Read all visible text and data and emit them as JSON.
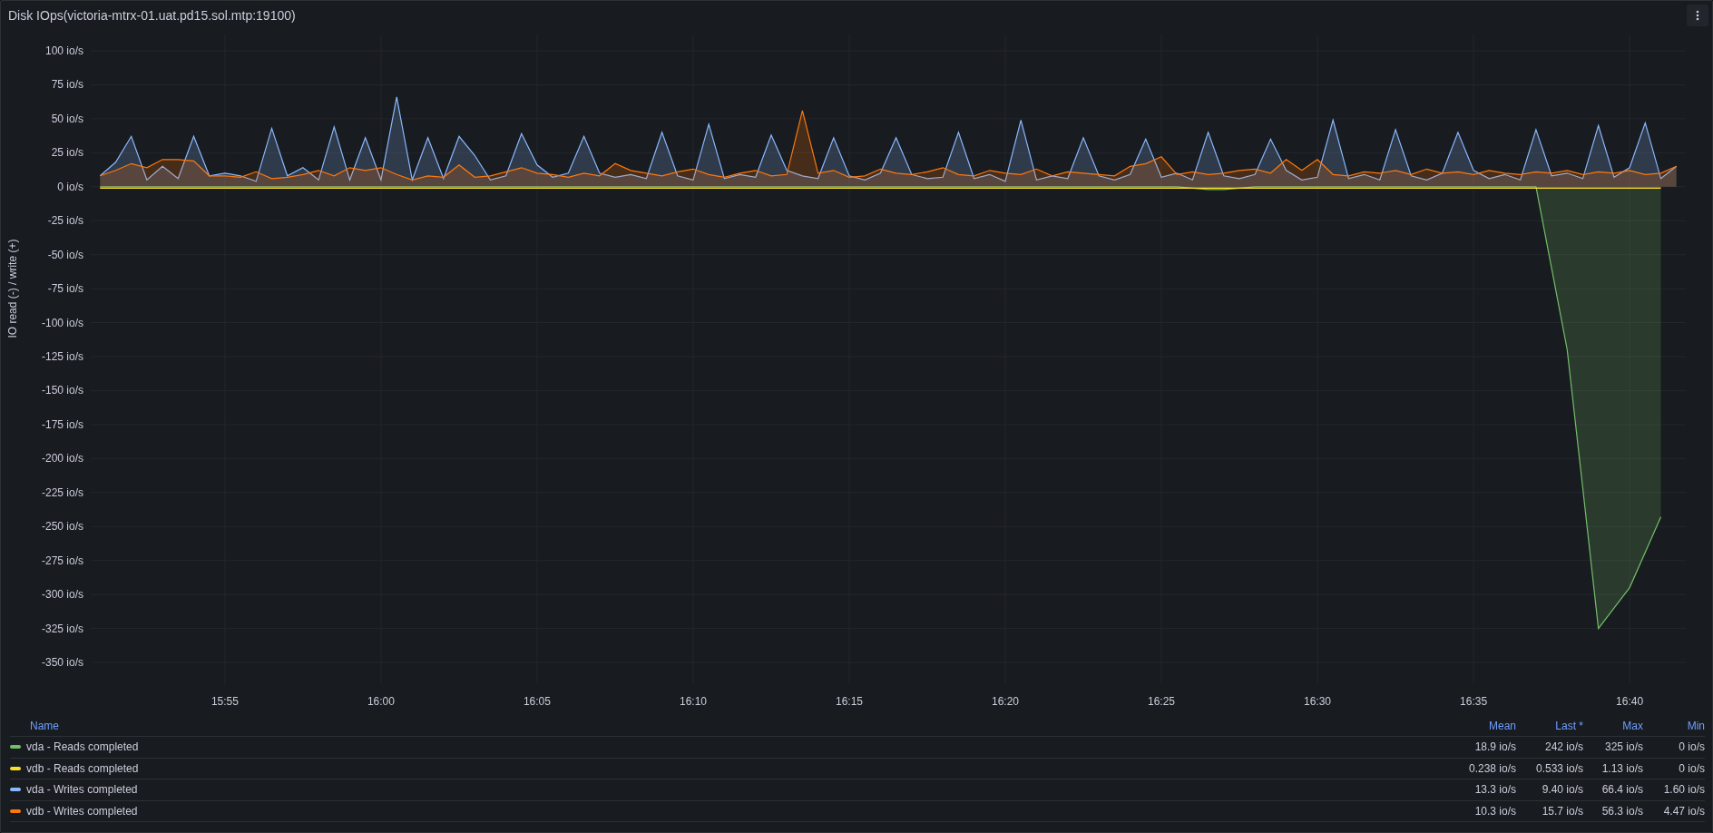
{
  "panel": {
    "title": "Disk IOps(victoria-mtrx-01.uat.pd15.sol.mtp:19100)"
  },
  "chart_data": {
    "type": "area",
    "ylabel": "IO read (-) / write (+)",
    "grid": true,
    "ylim": [
      -366,
      112
    ],
    "yticks": [
      {
        "value": 100,
        "label": "100 io/s"
      },
      {
        "value": 75,
        "label": "75 io/s"
      },
      {
        "value": 50,
        "label": "50 io/s"
      },
      {
        "value": 25,
        "label": "25 io/s"
      },
      {
        "value": 0,
        "label": "0 io/s"
      },
      {
        "value": -25,
        "label": "-25 io/s"
      },
      {
        "value": -50,
        "label": "-50 io/s"
      },
      {
        "value": -75,
        "label": "-75 io/s"
      },
      {
        "value": -100,
        "label": "-100 io/s"
      },
      {
        "value": -125,
        "label": "-125 io/s"
      },
      {
        "value": -150,
        "label": "-150 io/s"
      },
      {
        "value": -175,
        "label": "-175 io/s"
      },
      {
        "value": -200,
        "label": "-200 io/s"
      },
      {
        "value": -225,
        "label": "-225 io/s"
      },
      {
        "value": -250,
        "label": "-250 io/s"
      },
      {
        "value": -275,
        "label": "-275 io/s"
      },
      {
        "value": -300,
        "label": "-300 io/s"
      },
      {
        "value": -325,
        "label": "-325 io/s"
      },
      {
        "value": -350,
        "label": "-350 io/s"
      }
    ],
    "categories": [
      null,
      null,
      null,
      null,
      null,
      null,
      null,
      null,
      "15:55",
      null,
      null,
      null,
      null,
      null,
      null,
      null,
      null,
      null,
      "16:00",
      null,
      null,
      null,
      null,
      null,
      null,
      null,
      null,
      null,
      "16:05",
      null,
      null,
      null,
      null,
      null,
      null,
      null,
      null,
      null,
      "16:10",
      null,
      null,
      null,
      null,
      null,
      null,
      null,
      null,
      null,
      "16:15",
      null,
      null,
      null,
      null,
      null,
      null,
      null,
      null,
      null,
      "16:20",
      null,
      null,
      null,
      null,
      null,
      null,
      null,
      null,
      null,
      "16:25",
      null,
      null,
      null,
      null,
      null,
      null,
      null,
      null,
      null,
      "16:30",
      null,
      null,
      null,
      null,
      null,
      null,
      null,
      null,
      null,
      "16:35",
      null,
      null,
      null,
      null,
      null,
      null,
      null,
      null,
      null,
      "16:40",
      null,
      null,
      null
    ],
    "series": [
      {
        "name": "vda - Reads completed",
        "color": "#73bf69",
        "values": [
          0,
          0,
          0,
          0,
          0,
          0,
          0,
          0,
          0,
          0,
          0,
          0,
          0,
          0,
          0,
          0,
          0,
          0,
          0,
          0,
          0,
          0,
          0,
          0,
          0,
          0,
          0,
          0,
          0,
          0,
          0,
          0,
          0,
          0,
          0,
          0,
          0,
          0,
          0,
          0,
          0,
          0,
          0,
          0,
          0,
          0,
          0,
          0,
          0,
          0,
          0,
          0,
          0,
          0,
          0,
          0,
          0,
          0,
          0,
          0,
          0,
          0,
          0,
          0,
          0,
          0,
          0,
          0,
          0,
          0,
          -1,
          -2,
          -2,
          -1,
          0,
          0,
          0,
          0,
          0,
          0,
          0,
          0,
          0,
          0,
          0,
          0,
          0,
          0,
          0,
          0,
          0,
          0,
          0,
          -60,
          -120,
          -222,
          -325,
          -310,
          -295,
          -269,
          -243,
          null
        ]
      },
      {
        "name": "vdb - Reads completed",
        "color": "#fade2a",
        "values": [
          -1,
          -1,
          -1,
          -1,
          -1,
          -1,
          -1,
          -1,
          -1,
          -1,
          -1,
          -1,
          -1,
          -1,
          -1,
          -1,
          -1,
          -1,
          -1,
          -1,
          -1,
          -1,
          -1,
          -1,
          -1,
          -1,
          -1,
          -1,
          -1,
          -1,
          -1,
          -1,
          -1,
          -1,
          -1,
          -1,
          -1,
          -1,
          -1,
          -1,
          -1,
          -1,
          -1,
          -1,
          -1,
          -1,
          -1,
          -1,
          -1,
          -1,
          -1,
          -1,
          -1,
          -1,
          -1,
          -1,
          -1,
          -1,
          -1,
          -1,
          -1,
          -1,
          -1,
          -1,
          -1,
          -1,
          -1,
          -1,
          -1,
          -1,
          -1,
          -1,
          -1,
          -1,
          -1,
          -1,
          -1,
          -1,
          -1,
          -1,
          -1,
          -1,
          -1,
          -1,
          -1,
          -1,
          -1,
          -1,
          -1,
          -1,
          -1,
          -1,
          -1,
          -1,
          -1,
          -1,
          -1,
          -1,
          -1,
          -1,
          -1,
          null
        ]
      },
      {
        "name": "vda - Writes completed",
        "color": "#8ab8ff",
        "values": [
          8,
          18,
          37,
          5,
          15,
          6,
          37,
          8,
          10,
          8,
          4,
          43,
          8,
          14,
          5,
          44,
          5,
          36,
          5,
          66,
          5,
          36,
          6,
          37,
          23,
          5,
          8,
          39,
          16,
          7,
          10,
          37,
          10,
          7,
          9,
          6,
          40,
          8,
          5,
          46,
          6,
          9,
          7,
          38,
          12,
          8,
          6,
          36,
          8,
          5,
          10,
          36,
          9,
          6,
          7,
          40,
          6,
          9,
          4,
          49,
          5,
          8,
          6,
          36,
          8,
          5,
          9,
          35,
          7,
          10,
          5,
          40,
          8,
          6,
          9,
          35,
          12,
          5,
          7,
          49,
          6,
          9,
          5,
          42,
          8,
          5,
          10,
          40,
          12,
          6,
          9,
          5,
          42,
          8,
          10,
          6,
          45,
          7,
          14,
          47,
          6,
          15
        ]
      },
      {
        "name": "vdb - Writes completed",
        "color": "#ff780a",
        "values": [
          8,
          12,
          17,
          14,
          20,
          20,
          19,
          8,
          8,
          7,
          11,
          6,
          7,
          9,
          12,
          8,
          14,
          12,
          14,
          9,
          5,
          8,
          7,
          16,
          7,
          8,
          11,
          14,
          10,
          9,
          7,
          10,
          8,
          17,
          12,
          10,
          8,
          11,
          13,
          9,
          7,
          10,
          12,
          8,
          9,
          56,
          10,
          12,
          7,
          8,
          13,
          10,
          9,
          11,
          14,
          9,
          8,
          12,
          10,
          9,
          13,
          8,
          11,
          10,
          9,
          8,
          15,
          17,
          22,
          9,
          11,
          9,
          10,
          12,
          13,
          10,
          20,
          12,
          20,
          9,
          8,
          11,
          10,
          12,
          9,
          13,
          10,
          11,
          9,
          12,
          10,
          9,
          11,
          10,
          12,
          9,
          11,
          10,
          12,
          9,
          10,
          15
        ]
      }
    ]
  },
  "legend": {
    "columns": [
      "Name",
      "Mean",
      "Last *",
      "Max",
      "Min"
    ],
    "rows": [
      {
        "mean": "18.9 io/s",
        "last": "242 io/s",
        "max": "325 io/s",
        "min": "0 io/s"
      },
      {
        "mean": "0.238 io/s",
        "last": "0.533 io/s",
        "max": "1.13 io/s",
        "min": "0 io/s"
      },
      {
        "mean": "13.3 io/s",
        "last": "9.40 io/s",
        "max": "66.4 io/s",
        "min": "1.60 io/s"
      },
      {
        "mean": "10.3 io/s",
        "last": "15.7 io/s",
        "max": "56.3 io/s",
        "min": "4.47 io/s"
      }
    ]
  }
}
